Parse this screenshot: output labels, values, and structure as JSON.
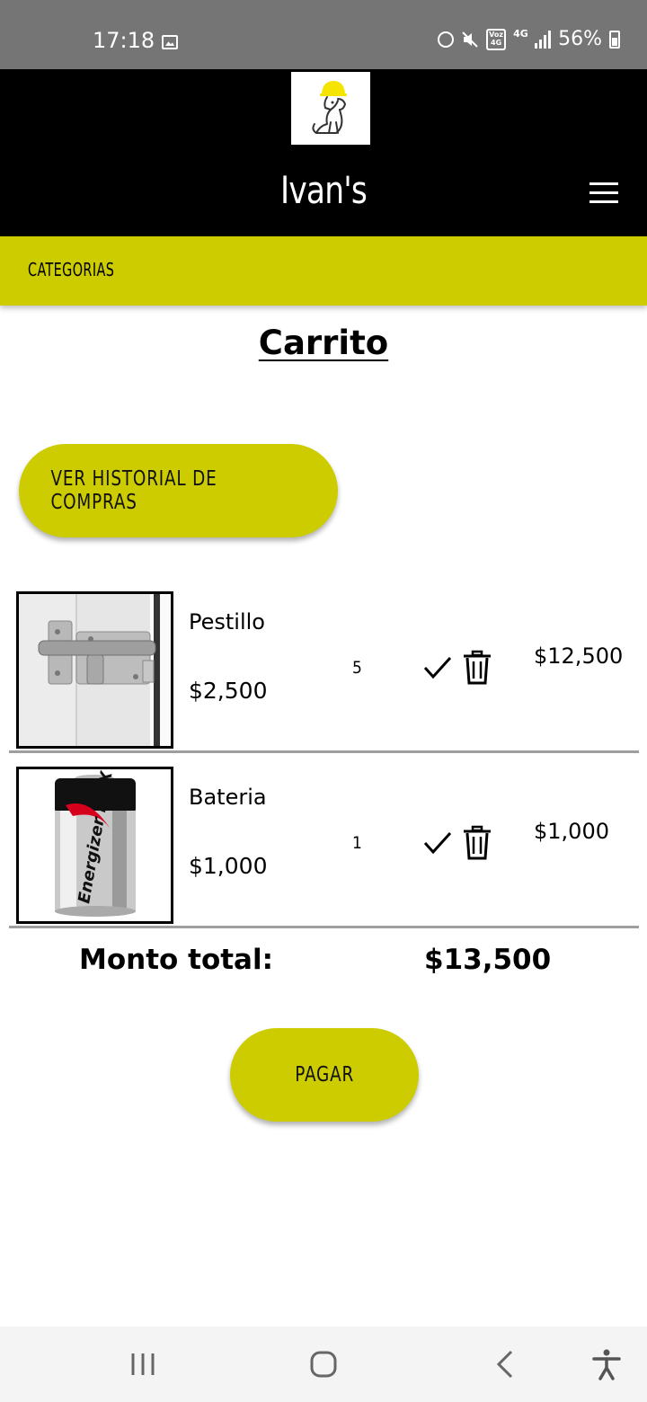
{
  "status_bar": {
    "time": "17:18",
    "battery": "56%",
    "network": "4G",
    "volte": "Voz 4G",
    "icons": [
      "image-icon",
      "alarm-icon",
      "mute-icon",
      "volte-icon",
      "network-4g-icon",
      "signal-icon",
      "battery-charging-icon"
    ]
  },
  "header": {
    "title": "Ivan's",
    "logo_icon": "dog-with-hardhat-logo",
    "menu_icon": "hamburger-menu-icon"
  },
  "categories": {
    "label": "CATEGORIAS"
  },
  "page": {
    "title": "Carrito"
  },
  "history_button": {
    "label": "VER HISTORIAL DE COMPRAS"
  },
  "cart": {
    "items": [
      {
        "name": "Pestillo",
        "price": "$2,500",
        "quantity": "5",
        "subtotal": "$12,500",
        "image": "door-latch"
      },
      {
        "name": "Bateria",
        "price": "$1,000",
        "quantity": "1",
        "subtotal": "$1,000",
        "image": "energizer-battery",
        "image_text": "Energizer MAX"
      }
    ],
    "item_icons": [
      "check-icon",
      "trash-icon"
    ]
  },
  "total": {
    "label": "Monto total:",
    "value": "$13,500"
  },
  "pay_button": {
    "label": "PAGAR"
  },
  "nav": {
    "icons": [
      "recent-apps-icon",
      "home-icon",
      "back-icon",
      "accessibility-icon"
    ]
  },
  "colors": {
    "accent": "#cccc00",
    "header_bg": "#000000",
    "status_bg": "#757575"
  }
}
